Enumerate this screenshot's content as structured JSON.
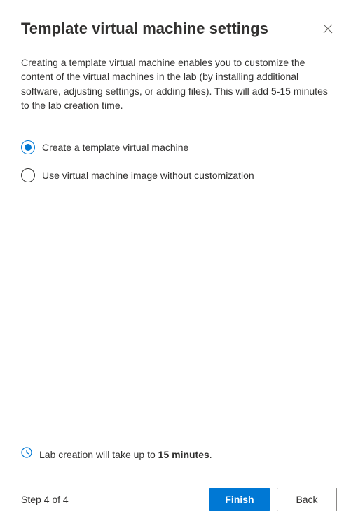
{
  "header": {
    "title": "Template virtual machine settings"
  },
  "description": "Creating a template virtual machine enables you to customize the content of the virtual machines in the lab (by installing additional software, adjusting settings, or adding files). This will add 5-15 minutes to the lab creation time.",
  "options": {
    "create_template": "Create a template virtual machine",
    "use_image": "Use virtual machine image without customization",
    "selected": "create_template"
  },
  "info": {
    "prefix": "Lab creation will take up to ",
    "bold": "15 minutes",
    "suffix": "."
  },
  "footer": {
    "step_text": "Step 4 of 4",
    "finish_label": "Finish",
    "back_label": "Back"
  },
  "colors": {
    "primary": "#0078d4"
  }
}
